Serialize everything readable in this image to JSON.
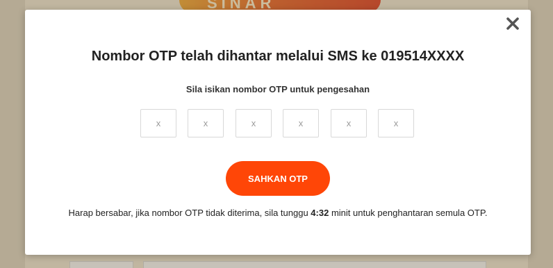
{
  "background": {
    "logo_text": "SINAR"
  },
  "modal": {
    "title": "Nombor OTP telah dihantar melalui SMS ke 019514XXXX",
    "subtitle": "Sila isikan nombor OTP untuk pengesahan",
    "close_icon": "close-icon",
    "otp_inputs": [
      {
        "value": "",
        "placeholder": "x"
      },
      {
        "value": "",
        "placeholder": "x"
      },
      {
        "value": "",
        "placeholder": "x"
      },
      {
        "value": "",
        "placeholder": "x"
      },
      {
        "value": "",
        "placeholder": "x"
      },
      {
        "value": "",
        "placeholder": "x"
      }
    ],
    "submit_label": "SAHKAN OTP",
    "notice_before": "Harap bersabar, jika nombor OTP tidak diterima, sila tunggu ",
    "timer": "4:32",
    "notice_after": " minit untuk penghantaran semula OTP."
  },
  "colors": {
    "accent": "#ff4607",
    "overlay": "#b5ab95"
  }
}
